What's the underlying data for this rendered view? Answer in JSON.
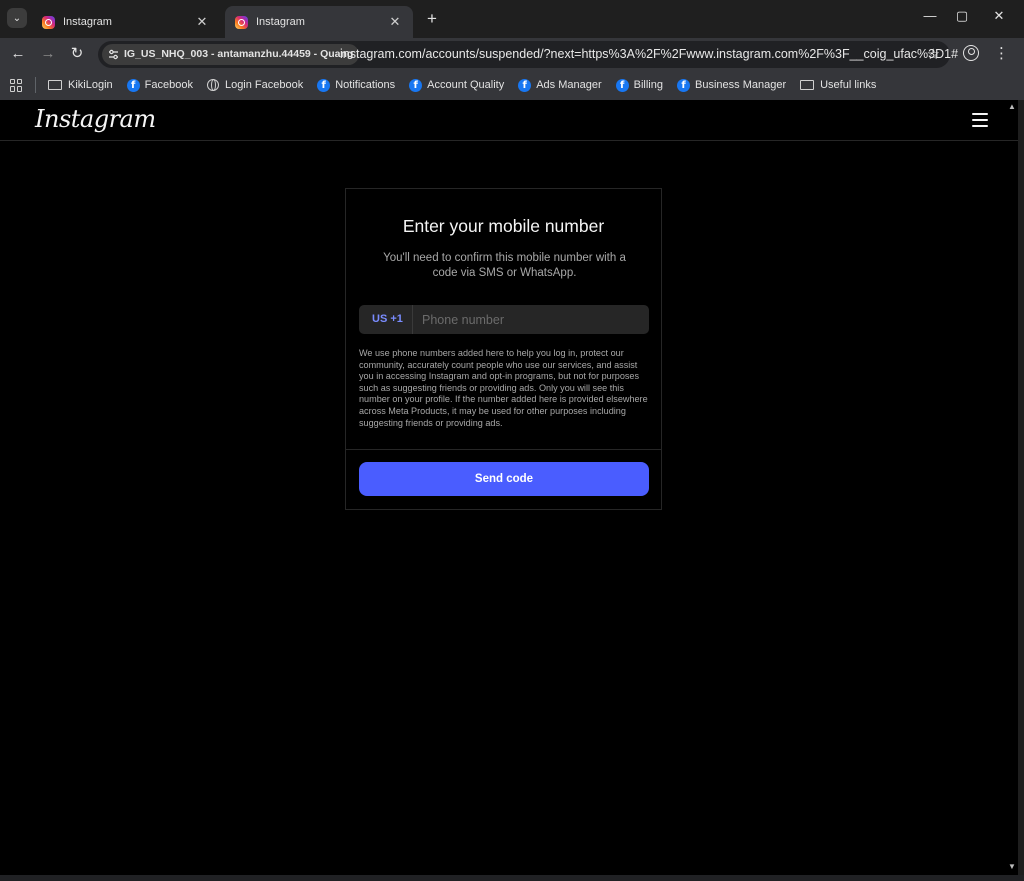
{
  "browser": {
    "tabs": [
      {
        "title": "Instagram",
        "active": false
      },
      {
        "title": "Instagram",
        "active": true
      }
    ],
    "site_chip": "IG_US_NHQ_003 - antamanzhu.44459 - Quang",
    "url": "instagram.com/accounts/suspended/?next=https%3A%2F%2Fwww.instagram.com%2F%3F__coig_ufac%3D1#",
    "bookmarks": [
      {
        "label": "KikiLogin",
        "icon": "folder-icon"
      },
      {
        "label": "Facebook",
        "icon": "facebook-icon"
      },
      {
        "label": "Login Facebook",
        "icon": "globe-icon"
      },
      {
        "label": "Notifications",
        "icon": "facebook-icon"
      },
      {
        "label": "Account Quality",
        "icon": "facebook-icon"
      },
      {
        "label": "Ads Manager",
        "icon": "facebook-icon"
      },
      {
        "label": "Billing",
        "icon": "facebook-icon"
      },
      {
        "label": "Business Manager",
        "icon": "facebook-icon"
      },
      {
        "label": "Useful links",
        "icon": "folder-icon"
      }
    ]
  },
  "page": {
    "logo": "Instagram",
    "title": "Enter your mobile number",
    "description": "You'll need to confirm this mobile number with a code via SMS or WhatsApp.",
    "country_code": "US +1",
    "phone_placeholder": "Phone number",
    "phone_value": "",
    "disclaimer": "We use phone numbers added here to help you log in, protect our community, accurately count people who use our services, and assist you in accessing Instagram and opt-in programs, but not for purposes such as suggesting friends or providing ads. Only you will see this number on your profile. If the number added here is provided elsewhere across Meta Products, it may be used for other purposes including suggesting friends or providing ads.",
    "send_label": "Send code",
    "accent_color": "#4a5dff"
  }
}
